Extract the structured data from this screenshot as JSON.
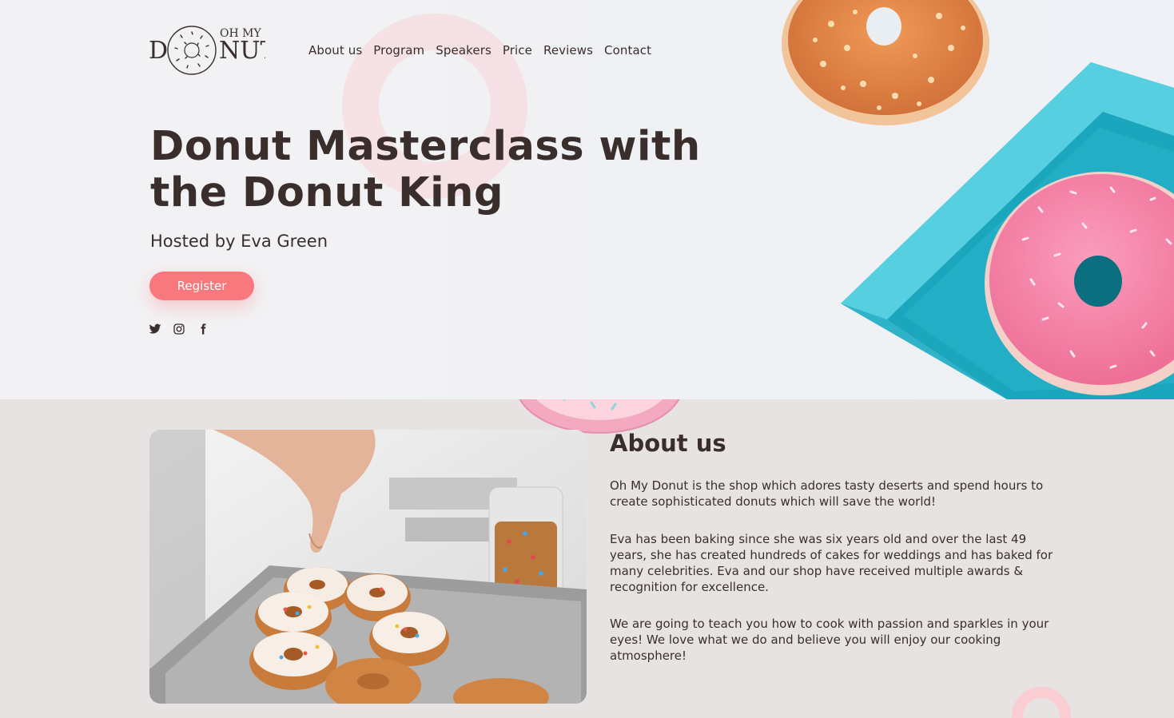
{
  "brand": {
    "logo_small": "OH MY",
    "logo_left": "D",
    "logo_right": "NUT"
  },
  "nav": {
    "items": [
      {
        "label": "About us"
      },
      {
        "label": "Program"
      },
      {
        "label": "Speakers"
      },
      {
        "label": "Price"
      },
      {
        "label": "Reviews"
      },
      {
        "label": "Contact"
      }
    ]
  },
  "hero": {
    "title_line1": "Donut Masterclass with",
    "title_line2": "the Donut King",
    "subtitle": "Hosted by Eva Green",
    "register_label": "Register",
    "socials": [
      {
        "icon": "twitter-icon"
      },
      {
        "icon": "instagram-icon"
      },
      {
        "icon": "facebook-icon"
      }
    ]
  },
  "about": {
    "title": "About us",
    "paragraphs": [
      "Oh My Donut is the shop which adores tasty deserts and spend hours to create sophisticated donuts which will save the world!",
      "Eva has been baking since she was six years old and over the last 49 years, she has created hundreds of cakes for weddings and has baked for many celebrities. Eva and our shop have received multiple awards & recognition for excellence.",
      "We are going to teach you how to cook with passion and sparkles in your eyes! We love what we do and believe you will enjoy our cooking atmosphere!"
    ]
  },
  "colors": {
    "accent": "#f8787e",
    "text": "#3a2e2c",
    "hero_bg": "#f2f2f4",
    "section_bg": "#e8e3e3",
    "box_blue": "#3ec3d6",
    "pink_glaze": "#f47fa3",
    "orange_glaze": "#e6884a"
  }
}
